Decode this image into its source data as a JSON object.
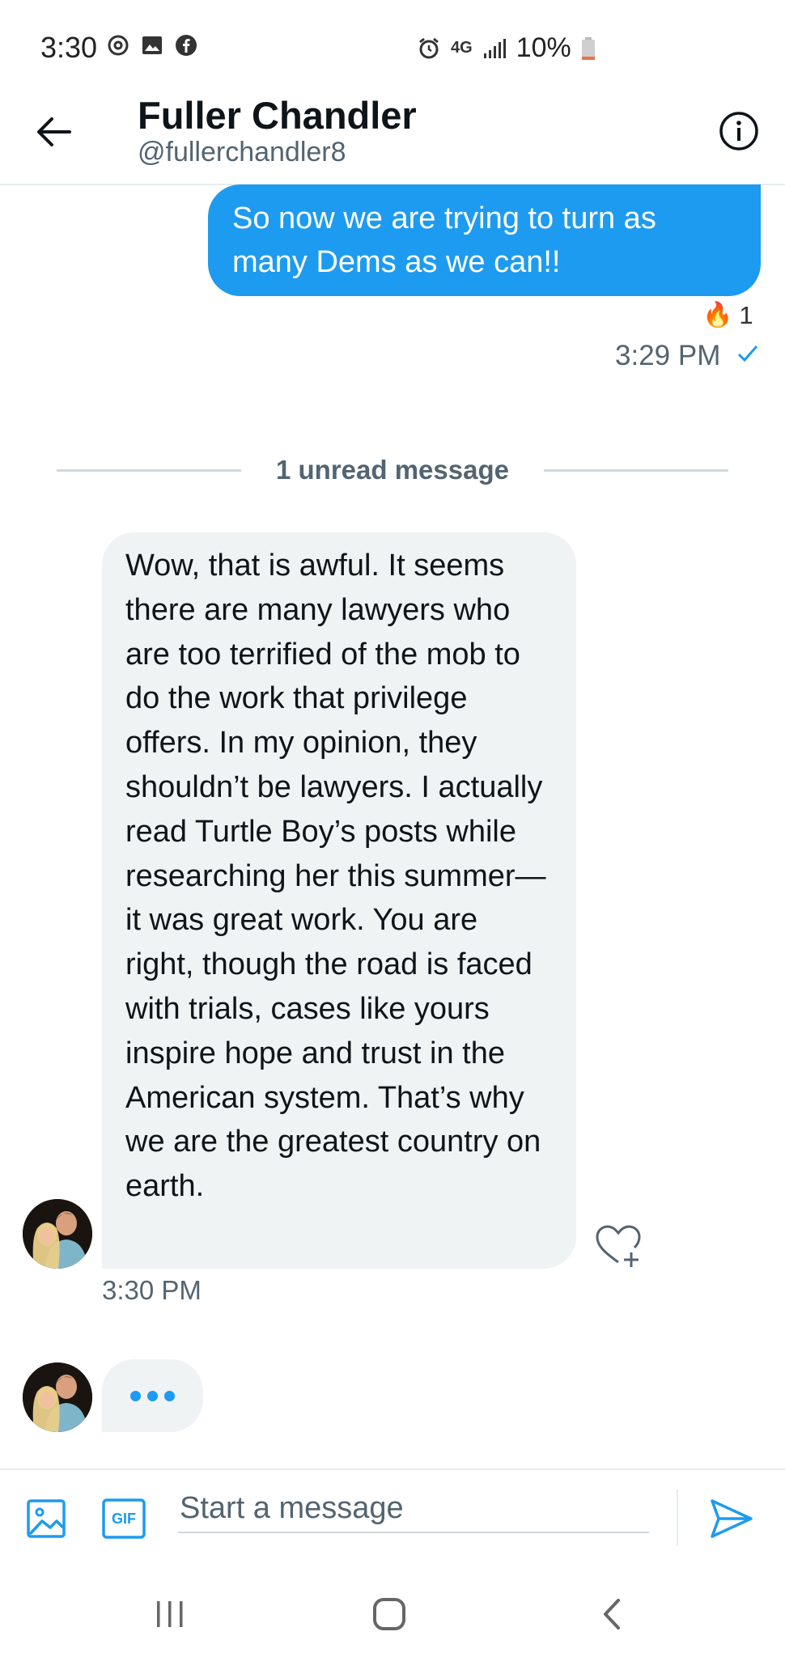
{
  "status_bar": {
    "time": "3:30",
    "network": "4G",
    "battery": "10%"
  },
  "header": {
    "name": "Fuller Chandler",
    "handle": "@fullerchandler8"
  },
  "messages": {
    "sent": {
      "text": "So now we are trying to turn as many Dems as we can!!",
      "reaction_emoji": "🔥",
      "reaction_count": "1",
      "time": "3:29 PM"
    },
    "unread_divider": "1 unread message",
    "received": {
      "text": "Wow, that is awful. It seems there are many lawyers who are too terrified of the mob to do the work that privilege offers. In my opinion, they shouldn’t be lawyers. I actually read Turtle Boy’s posts while researching her this summer—it was great work. You are right, though the road is faced with trials, cases like yours inspire hope and trust in the American system. That’s why we are the greatest country on earth.",
      "time": "3:30 PM"
    }
  },
  "composer": {
    "placeholder": "Start a message",
    "gif_label": "GIF"
  },
  "colors": {
    "accent": "#1d9bf0",
    "bubble_received": "#eff3f4",
    "secondary_text": "#536471"
  },
  "icons": {
    "back": "arrow-left-icon",
    "info": "info-icon",
    "reaction": "fire-icon",
    "read": "check-icon",
    "heart_add": "heart-plus-icon",
    "media": "image-icon",
    "gif": "gif-icon",
    "send": "send-icon"
  }
}
